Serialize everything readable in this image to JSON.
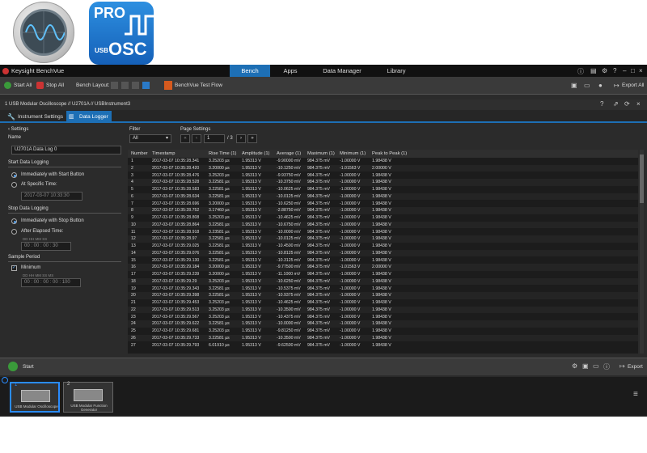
{
  "logos": {
    "pro_text": "PRO",
    "usb_text": "USB",
    "osc_text": "OSC"
  },
  "app": {
    "title": "Keysight BenchVue"
  },
  "nav": {
    "tabs": [
      "Bench",
      "Apps",
      "Data Manager",
      "Library"
    ],
    "active": "Bench"
  },
  "toolbar": {
    "start_all": "Start All",
    "stop_all": "Stop All",
    "bench_layout": "Bench Layout:",
    "test_flow": "BenchVue Test Flow",
    "export_all": "Export All"
  },
  "instrument": {
    "path": "1  USB Modular Oscilloscope // U2701A // USBInstrument3"
  },
  "subtabs": {
    "settings": "Instrument Settings",
    "logger": "Data Logger"
  },
  "settings": {
    "header": "Settings",
    "name_label": "Name",
    "name_value": "U2701A Data Log 0",
    "start_section": "Start Data Logging",
    "start_opt1": "Immediately with Start Button",
    "start_opt2": "At Specific Time:",
    "start_time": "2017-03-07 10:33:30",
    "stop_section": "Stop Data Logging",
    "stop_opt1": "Immediately with Stop Button",
    "stop_opt2": "After Elapsed Time:",
    "elapsed_labels": "DD   HH   MM   SS",
    "elapsed_value": "00 : 00 : 00 : 30",
    "sample_section": "Sample Period",
    "minimum": "Minimum",
    "sample_labels": "DD   HH   MM   SS   MS",
    "sample_value": "00 : 00 : 00 : 00 : 100"
  },
  "filter": {
    "label": "Filter",
    "value": "All"
  },
  "paging": {
    "label": "Page Settings",
    "page": "1",
    "of": "/ 3"
  },
  "table": {
    "columns": [
      "Number",
      "Timestamp",
      "Rise Time (1)",
      "Amplitude (1)",
      "Average (1)",
      "Maximum (1)",
      "Minimum (1)",
      "Peak to Peak (1)"
    ],
    "rows": [
      [
        "1",
        "2017-03-07 10:35:28.341",
        "3.25203 µs",
        "1.95313 V",
        "-9.90000 mV",
        "984.375 mV",
        "-1.00000 V",
        "1.98438 V"
      ],
      [
        "2",
        "2017-03-07 10:35:28.420",
        "3.20000 µs",
        "1.95313 V",
        "-10.1250 mV",
        "984.375 mV",
        "-1.01563 V",
        "2.00000 V"
      ],
      [
        "3",
        "2017-03-07 10:35:28.476",
        "3.25203 µs",
        "1.95313 V",
        "-9.93750 mV",
        "984.375 mV",
        "-1.00000 V",
        "1.98438 V"
      ],
      [
        "4",
        "2017-03-07 10:35:28.528",
        "3.22581 µs",
        "1.95313 V",
        "-10.3750 mV",
        "984.375 mV",
        "-1.00000 V",
        "1.98438 V"
      ],
      [
        "5",
        "2017-03-07 10:35:28.583",
        "3.22581 µs",
        "1.95313 V",
        "-10.0625 mV",
        "984.375 mV",
        "-1.00000 V",
        "1.98438 V"
      ],
      [
        "6",
        "2017-03-07 10:35:28.634",
        "3.22581 µs",
        "1.95313 V",
        "-10.0125 mV",
        "984.375 mV",
        "-1.00000 V",
        "1.98438 V"
      ],
      [
        "7",
        "2017-03-07 10:35:28.696",
        "3.20000 µs",
        "1.95313 V",
        "-10.6250 mV",
        "984.375 mV",
        "-1.00000 V",
        "1.98438 V"
      ],
      [
        "8",
        "2017-03-07 10:35:28.752",
        "3.17460 µs",
        "1.95313 V",
        "-2.88750 mV",
        "984.375 mV",
        "-1.00000 V",
        "1.98438 V"
      ],
      [
        "9",
        "2017-03-07 10:35:28.808",
        "3.25203 µs",
        "1.95313 V",
        "-10.4625 mV",
        "984.375 mV",
        "-1.00000 V",
        "1.98438 V"
      ],
      [
        "10",
        "2017-03-07 10:35:28.864",
        "3.22581 µs",
        "1.95313 V",
        "-10.6750 mV",
        "984.375 mV",
        "-1.00000 V",
        "1.98438 V"
      ],
      [
        "11",
        "2017-03-07 10:35:28.918",
        "3.23581 µs",
        "1.95313 V",
        "-10.0000 mV",
        "984.375 mV",
        "-1.00000 V",
        "1.98438 V"
      ],
      [
        "12",
        "2017-03-07 10:35:28.97",
        "3.22581 µs",
        "1.95313 V",
        "-10.0125 mV",
        "984.375 mV",
        "-1.00000 V",
        "1.98438 V"
      ],
      [
        "13",
        "2017-03-07 10:35:29.025",
        "3.22581 µs",
        "1.95313 V",
        "-10.4500 mV",
        "984.375 mV",
        "-1.00000 V",
        "1.98438 V"
      ],
      [
        "14",
        "2017-03-07 10:35:29.076",
        "3.22581 µs",
        "1.95313 V",
        "-10.8125 mV",
        "984.375 mV",
        "-1.00000 V",
        "1.98438 V"
      ],
      [
        "15",
        "2017-03-07 10:35:29.130",
        "3.22581 µs",
        "1.95313 V",
        "-10.3125 mV",
        "984.375 mV",
        "-1.00000 V",
        "1.98438 V"
      ],
      [
        "16",
        "2017-03-07 10:35:29.184",
        "3.20000 µs",
        "1.95313 V",
        "-9.77500 mV",
        "984.375 mV",
        "-1.01563 V",
        "2.00000 V"
      ],
      [
        "17",
        "2017-03-07 10:35:29.239",
        "3.20000 µs",
        "1.95313 V",
        "-11.1000 mV",
        "984.375 mV",
        "-1.00000 V",
        "1.98438 V"
      ],
      [
        "18",
        "2017-03-07 10:35:29.29",
        "3.25203 µs",
        "1.95313 V",
        "-10.6250 mV",
        "984.375 mV",
        "-1.00000 V",
        "1.98438 V"
      ],
      [
        "19",
        "2017-03-07 10:35:29.343",
        "3.22581 µs",
        "1.95313 V",
        "-10.5375 mV",
        "984.375 mV",
        "-1.00000 V",
        "1.98438 V"
      ],
      [
        "20",
        "2017-03-07 10:35:29.398",
        "3.22581 µs",
        "1.95313 V",
        "-10.9375 mV",
        "984.375 mV",
        "-1.00000 V",
        "1.98438 V"
      ],
      [
        "21",
        "2017-03-07 10:35:29.453",
        "3.25203 µs",
        "1.95313 V",
        "-10.4625 mV",
        "984.375 mV",
        "-1.00000 V",
        "1.98438 V"
      ],
      [
        "22",
        "2017-03-07 10:35:29.513",
        "3.25203 µs",
        "1.95313 V",
        "-10.3500 mV",
        "984.375 mV",
        "-1.00000 V",
        "1.98438 V"
      ],
      [
        "23",
        "2017-03-07 10:35:29.567",
        "3.25203 µs",
        "1.95313 V",
        "-10.4375 mV",
        "984.375 mV",
        "-1.00000 V",
        "1.98438 V"
      ],
      [
        "24",
        "2017-03-07 10:35:29.622",
        "3.22581 µs",
        "1.95313 V",
        "-10.0000 mV",
        "984.375 mV",
        "-1.00000 V",
        "1.98438 V"
      ],
      [
        "25",
        "2017-03-07 10:35:29.681",
        "3.25203 µs",
        "1.95313 V",
        "-9.81250 mV",
        "984.375 mV",
        "-1.00000 V",
        "1.98438 V"
      ],
      [
        "26",
        "2017-03-07 10:35:29.733",
        "3.22581 µs",
        "1.95313 V",
        "-10.3500 mV",
        "984.375 mV",
        "-1.00000 V",
        "1.98438 V"
      ],
      [
        "27",
        "2017-03-07 10:35:29.793",
        "6.01910 µs",
        "1.95313 V",
        "-9.62500 mV",
        "984.375 mV",
        "-1.00000 V",
        "1.98438 V"
      ]
    ]
  },
  "bottom": {
    "start": "Start",
    "export": "Export"
  },
  "thumbs": [
    {
      "num": "1",
      "label": "USB Modular Oscilloscope"
    },
    {
      "num": "2",
      "label": "USB Modular Function Generator"
    }
  ]
}
